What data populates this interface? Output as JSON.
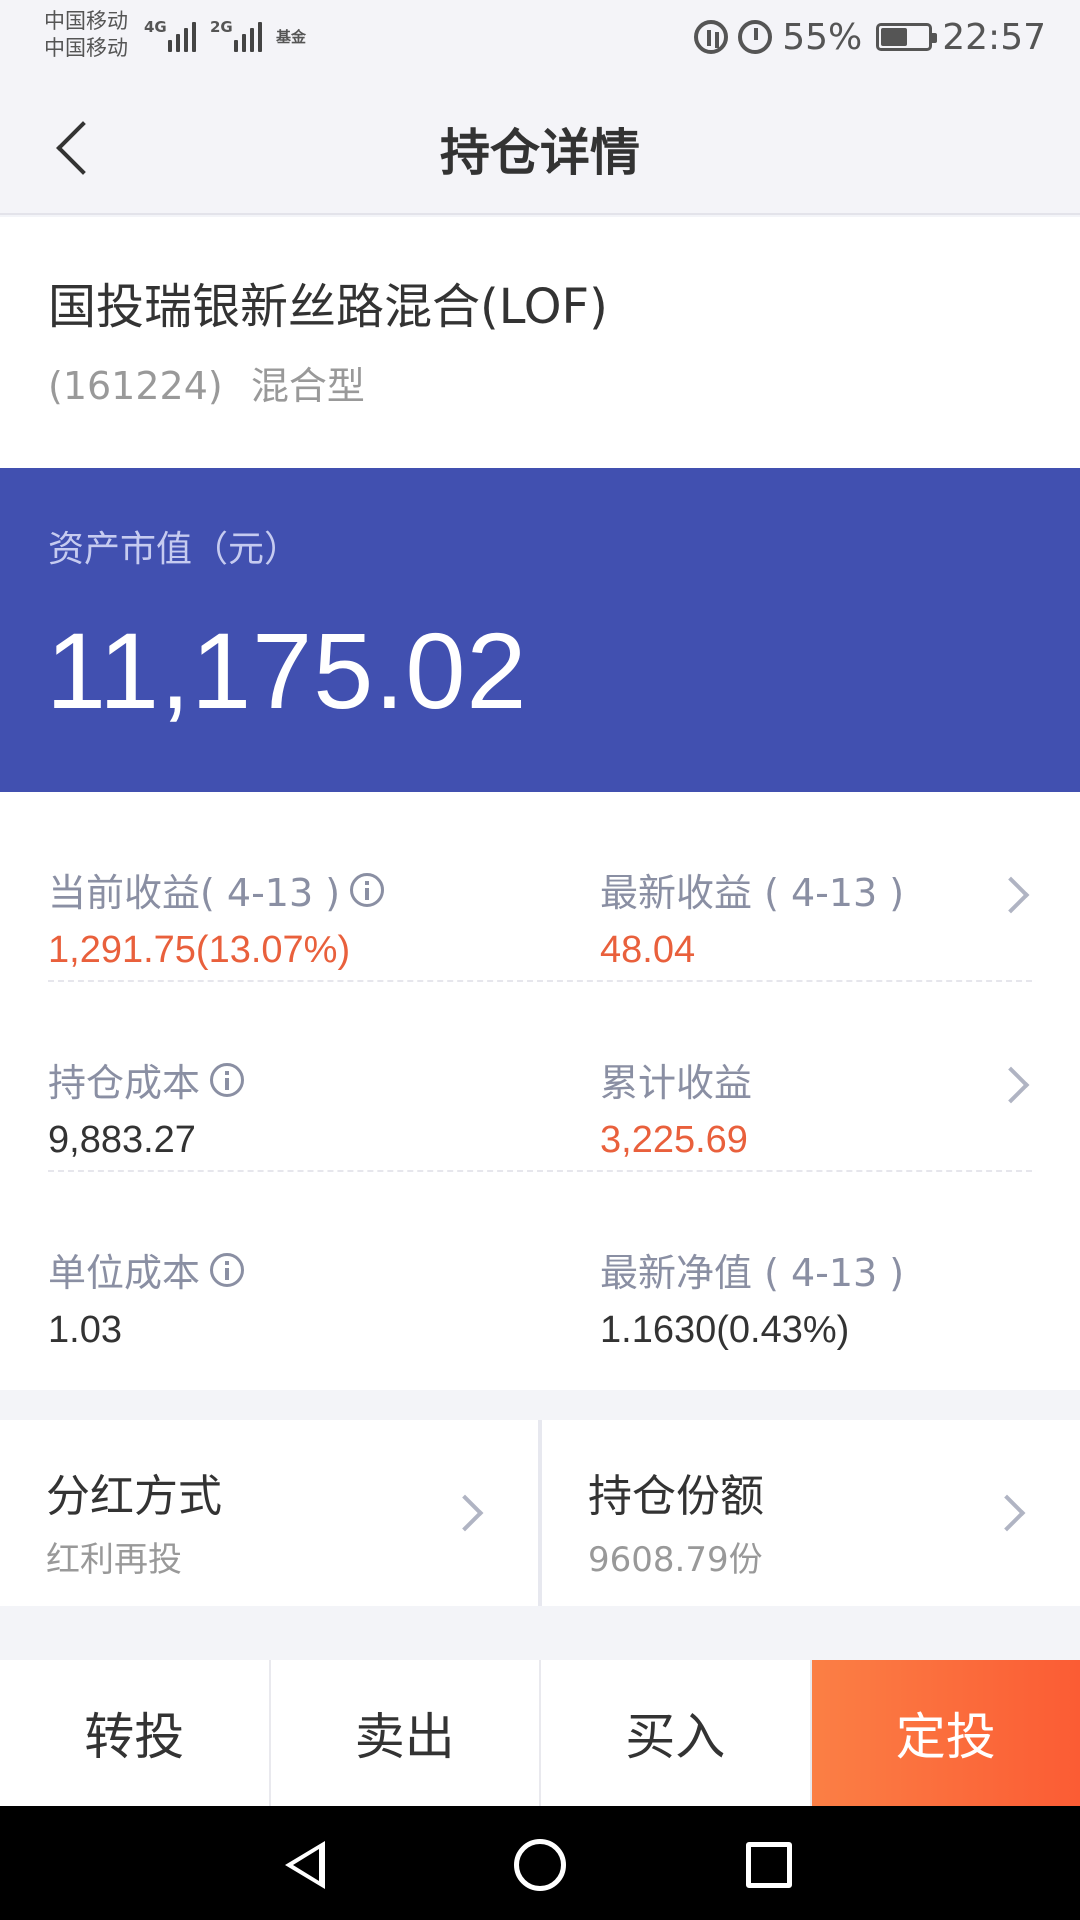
{
  "status_bar": {
    "carrier_1": "中国移动",
    "carrier_2": "中国移动",
    "network_1": "4G",
    "network_2": "2G",
    "fund_tag": "基金",
    "battery_percent": "55%",
    "battery_level": 0.55,
    "time": "22:57"
  },
  "header": {
    "title": "持仓详情"
  },
  "fund": {
    "name": "国投瑞银新丝路混合(LOF)",
    "code": "(161224)",
    "type": "混合型"
  },
  "asset": {
    "label": "资产市值（元）",
    "value": "11,175.02"
  },
  "stats": [
    {
      "left": {
        "label": "当前收益( 4-13 )",
        "value": "1,291.75(13.07%)",
        "info": true
      },
      "right": {
        "label": "最新收益 ( 4-13 )",
        "value": "48.04"
      }
    },
    {
      "left": {
        "label": "持仓成本",
        "value": "9,883.27",
        "info": true
      },
      "right": {
        "label": "累计收益",
        "value": "3,225.69"
      }
    },
    {
      "left": {
        "label": "单位成本",
        "value": "1.03",
        "info": true
      },
      "right": {
        "label": "最新净值 ( 4-13 )",
        "value": "1.1630(0.43%)"
      }
    }
  ],
  "cards": {
    "dividend": {
      "title": "分红方式",
      "value": "红利再投"
    },
    "shares": {
      "title": "持仓份额",
      "value": "9608.79份"
    }
  },
  "actions": {
    "switch": "转投",
    "sell": "卖出",
    "buy": "买入",
    "auto_invest": "定投"
  },
  "colors": {
    "primary_blue": "#4150b0",
    "profit_red": "#e9603c",
    "action_orange": "#fb6a3b"
  }
}
